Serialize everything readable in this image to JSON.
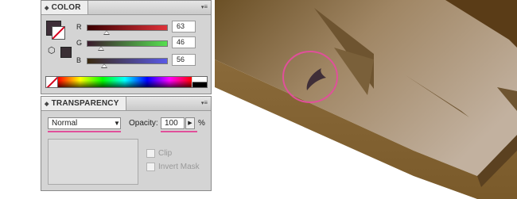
{
  "color_panel": {
    "tab_label": "COLOR",
    "menu_icon": "panel-menu-icon",
    "fill_color": "#3f2e38",
    "sliders": [
      {
        "label": "R",
        "value": "63",
        "knob_fraction": 0.25,
        "gradient": [
          "#3a0000",
          "#e0323a"
        ]
      },
      {
        "label": "G",
        "value": "46",
        "knob_fraction": 0.18,
        "gradient": [
          "#3a1a2c",
          "#56e050"
        ]
      },
      {
        "label": "B",
        "value": "56",
        "knob_fraction": 0.22,
        "gradient": [
          "#3a2a10",
          "#5a5ae8"
        ]
      }
    ]
  },
  "transparency_panel": {
    "tab_label": "TRANSPARENCY",
    "blend_mode": "Normal",
    "opacity_label": "Opacity:",
    "opacity_value": "100",
    "opacity_unit": "%",
    "clip_label": "Clip",
    "invert_mask_label": "Invert Mask"
  },
  "colors": {
    "highlight": "#e0509a",
    "wood_light": "#a38a68",
    "wood_dark": "#6b5026",
    "shape_fill": "#3f2e38"
  }
}
